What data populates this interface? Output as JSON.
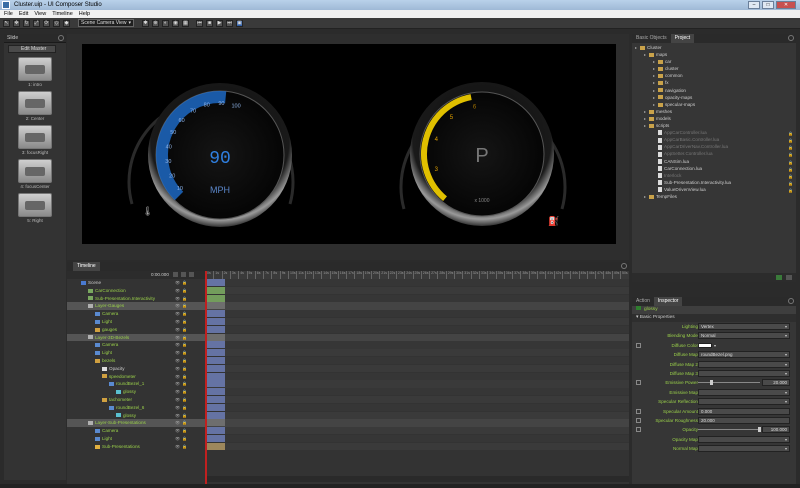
{
  "window": {
    "title": "Cluster.uip - UI Composer Studio"
  },
  "menu": [
    "File",
    "Edit",
    "View",
    "Timeline",
    "Help"
  ],
  "toolbar": {
    "view_select": "Scene Camera View"
  },
  "slides": {
    "panel_title": "Slide",
    "edit_master": "Edit Master",
    "items": [
      {
        "label": "1: intro"
      },
      {
        "label": "2: Center"
      },
      {
        "label": "3: focusRight"
      },
      {
        "label": "4: focusCenter"
      },
      {
        "label": "5: Right"
      }
    ]
  },
  "speedo": {
    "value": "90",
    "unit": "MPH",
    "ticks": [
      "10",
      "20",
      "30",
      "40",
      "50",
      "60",
      "70",
      "80",
      "90",
      "100"
    ],
    "fraction": 0.52
  },
  "tacho": {
    "gear": "P",
    "unit": "x 1000",
    "ticks": [
      "3",
      "4",
      "5",
      "6"
    ],
    "fraction": 0.45
  },
  "scene_tree": {
    "tabs": [
      "Basic Objects",
      "Project"
    ],
    "items": [
      {
        "label": "Cluster",
        "depth": 0,
        "folder": true
      },
      {
        "label": "maps",
        "depth": 1,
        "folder": true
      },
      {
        "label": "car",
        "depth": 2,
        "folder": true
      },
      {
        "label": "cluster",
        "depth": 2,
        "folder": true
      },
      {
        "label": "common",
        "depth": 2,
        "folder": true
      },
      {
        "label": "fx",
        "depth": 2,
        "folder": true
      },
      {
        "label": "navigation",
        "depth": 2,
        "folder": true
      },
      {
        "label": "opacity-maps",
        "depth": 2,
        "folder": true
      },
      {
        "label": "specular-maps",
        "depth": 2,
        "folder": true
      },
      {
        "label": "meshes",
        "depth": 1,
        "folder": true
      },
      {
        "label": "models",
        "depth": 1,
        "folder": true
      },
      {
        "label": "scripts",
        "depth": 1,
        "folder": true
      },
      {
        "label": "AppCarController.lua",
        "depth": 2,
        "dim": true
      },
      {
        "label": "AppCarBasic.Controller.lua",
        "depth": 2,
        "dim": true
      },
      {
        "label": "AppCarDriverNav.Controller.lua",
        "depth": 2,
        "dim": true
      },
      {
        "label": "AppSetter.Controller.lua",
        "depth": 2,
        "dim": true
      },
      {
        "label": "CANSim.lua",
        "depth": 2
      },
      {
        "label": "CarConnection.lua",
        "depth": 2
      },
      {
        "label": "Interlock",
        "depth": 2,
        "dim": true
      },
      {
        "label": "Sub-Presentation.Interactivity.lua",
        "depth": 2
      },
      {
        "label": "ValueDrivenView.lua",
        "depth": 2
      },
      {
        "label": "TempFiles",
        "depth": 1,
        "folder": true
      }
    ]
  },
  "timeline": {
    "tab": "Timeline",
    "time": "0:00.000",
    "ruler": [
      "0s",
      "1s",
      "2s",
      "3s",
      "4s",
      "5s",
      "6s",
      "7s",
      "8s",
      "9s",
      "10s",
      "11s",
      "12s",
      "13s",
      "14s",
      "15s",
      "16s",
      "17s",
      "18s",
      "19s",
      "20s",
      "21s",
      "22s",
      "23s",
      "24s",
      "25s",
      "26s",
      "27s",
      "28s",
      "29s",
      "30s",
      "31s",
      "32s",
      "33s",
      "34s",
      "35s",
      "36s",
      "37s",
      "38s",
      "39s",
      "40s",
      "41s",
      "42s",
      "43s",
      "44s",
      "45s",
      "46s",
      "47s",
      "48s",
      "49s",
      "50s"
    ],
    "rows": [
      {
        "label": "Scene",
        "depth": 0,
        "kind": "scene"
      },
      {
        "label": "CarConnection",
        "depth": 1,
        "kind": "behavior"
      },
      {
        "label": "Sub-Presentation.Interactivity",
        "depth": 1,
        "kind": "behavior"
      },
      {
        "label": "Layer-Gauges",
        "depth": 1,
        "kind": "layer",
        "sel": true
      },
      {
        "label": "Camera",
        "depth": 2,
        "kind": "camera"
      },
      {
        "label": "Light",
        "depth": 2,
        "kind": "light"
      },
      {
        "label": "gauges",
        "depth": 2,
        "kind": "group"
      },
      {
        "label": "Layer-3D-Bezels",
        "depth": 1,
        "kind": "layer",
        "sel": true
      },
      {
        "label": "Camera",
        "depth": 2,
        "kind": "camera"
      },
      {
        "label": "Light",
        "depth": 2,
        "kind": "light"
      },
      {
        "label": "bezels",
        "depth": 2,
        "kind": "group"
      },
      {
        "label": "Opacity",
        "depth": 3,
        "kind": "prop",
        "white": true
      },
      {
        "label": "speedometer",
        "depth": 3,
        "kind": "group"
      },
      {
        "label": "roundBezel_1",
        "depth": 4,
        "kind": "model"
      },
      {
        "label": "glossy",
        "depth": 5,
        "kind": "material"
      },
      {
        "label": "tachometer",
        "depth": 3,
        "kind": "group"
      },
      {
        "label": "roundBezel_6",
        "depth": 4,
        "kind": "model"
      },
      {
        "label": "glossy",
        "depth": 5,
        "kind": "material"
      },
      {
        "label": "Layer-Sub-Presentations",
        "depth": 1,
        "kind": "layer",
        "sel": true
      },
      {
        "label": "Camera",
        "depth": 2,
        "kind": "camera"
      },
      {
        "label": "Light",
        "depth": 2,
        "kind": "light"
      },
      {
        "label": "Sub-Presentations",
        "depth": 2,
        "kind": "component"
      }
    ]
  },
  "inspector": {
    "tabs": [
      "Action",
      "Inspector"
    ],
    "object": "glossy",
    "section": "Basic Properties",
    "props": [
      {
        "label": "Lighting",
        "value": "Vertex",
        "dd": true
      },
      {
        "label": "Blending Mode",
        "value": "Normal",
        "dd": true
      },
      {
        "label": "Diffuse Color",
        "value": "",
        "swatch": true,
        "key": true
      },
      {
        "label": "Diffuse Map",
        "value": "roundBezel.png",
        "dd": true
      },
      {
        "label": "Diffuse Map 2",
        "value": "",
        "dd": true
      },
      {
        "label": "Diffuse Map 3",
        "value": "",
        "dd": true
      },
      {
        "label": "Emissive Power",
        "value": "20.000",
        "slider": 0.2,
        "key": true
      },
      {
        "label": "Emissive Map",
        "value": "",
        "dd": true
      },
      {
        "label": "Specular Reflection",
        "value": "",
        "dd": true
      },
      {
        "label": "Specular Amount",
        "value": "0.000",
        "key": true
      },
      {
        "label": "Specular Roughness",
        "value": "20.000",
        "key": true
      },
      {
        "label": "Opacity",
        "value": "100.000",
        "slider": 1.0,
        "key": true
      },
      {
        "label": "Opacity Map",
        "value": "",
        "dd": true
      },
      {
        "label": "Normal Map",
        "value": "",
        "dd": true
      }
    ]
  }
}
